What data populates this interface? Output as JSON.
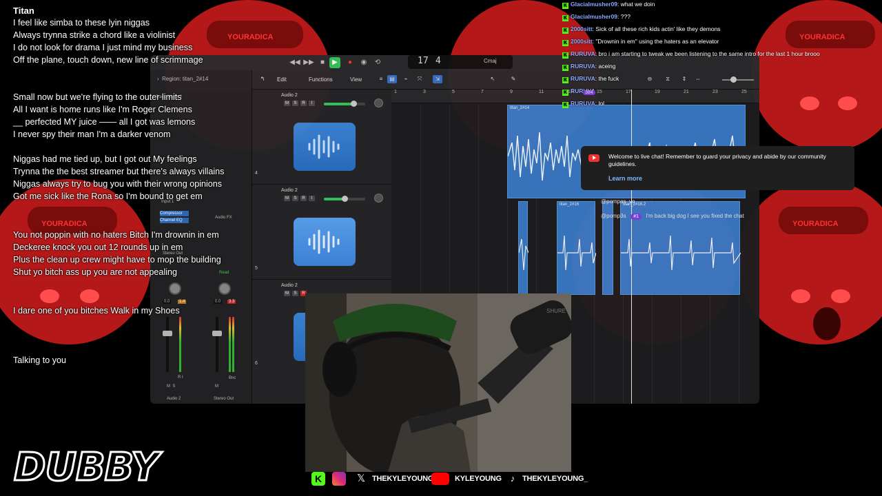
{
  "background": {
    "face_color": "#d21f1f",
    "brand_text": "YOURADICA"
  },
  "daw": {
    "region_label": "Region: titan_2#14",
    "track_label": "Track: Audio 2",
    "menus": [
      "Edit",
      "Functions",
      "View"
    ],
    "lcd": {
      "bar": "17",
      "beat": "4",
      "key": "Cmaj"
    },
    "ruler": [
      "1",
      "3",
      "5",
      "7",
      "9",
      "11",
      "13",
      "15",
      "17",
      "19",
      "21",
      "23",
      "25"
    ],
    "inspector": {
      "plugins": [
        "Compressor",
        "Channel EQ"
      ],
      "audio_fx": "Audio FX",
      "send_out": "Stereo Out",
      "read": "Read",
      "vol_a": "0.0",
      "vol_a_peak": "1.4",
      "vol_b": "0.0",
      "vol_b_peak": "3.3",
      "strip_a_name": "Audio 2",
      "strip_b_name": "Stereo Out",
      "bnc": "Bnc",
      "input": "Input 1"
    },
    "tracks": [
      {
        "num": "4",
        "name": "Audio 2",
        "volume": 0.72
      },
      {
        "num": "5",
        "name": "Audio 2",
        "volume": 0.5
      },
      {
        "num": "6",
        "name": "Audio 2",
        "volume": 0.5
      }
    ],
    "regions": [
      {
        "label": "titan_2#14"
      },
      {
        "label": "titan_2#16"
      },
      {
        "label": "titan_2#16.2"
      }
    ]
  },
  "lyrics": [
    "Titan",
    "I feel like simba to these lyin niggas",
    "Always trynna strike a chord like a violinist",
    "I do not look for drama I just mind my business",
    "Off the plane, touch down, new line of scrimmage",
    "",
    "Small now but we're flying to the outer limits",
    "All I want is home runs like I'm Roger Clemens",
    "__ perfected MY juice —— all I got was lemons",
    "I never spy  their man I'm a darker venom",
    "",
    "Niggas had me tied up, but I got out My feelings",
    "Trynna the the best streamer  but there's always villains",
    "Niggas always try to bug you with their wrong opinions",
    "Got me sick like the Rona so I'm bound to get em",
    "",
    "",
    "You not poppin with no haters Bitch I'm drownin in em",
    "Deckeree knock you out 12 rounds up in em",
    "Plus the clean up crew might have to mop the building",
    "Shut yo bitch ass up you are not appealing",
    "",
    "",
    "I dare one of you bitches Walk in my Shoes",
    "",
    "",
    "",
    "Talking to you"
  ],
  "chat": [
    {
      "user": "Glacialmusher09",
      "msg": "what we doin"
    },
    {
      "user": "Glacialmusher09",
      "msg": "???"
    },
    {
      "user": "2000sitt",
      "msg": "Sick of all these rich kids actin' like they demons"
    },
    {
      "user": "2000sitt",
      "msg": "\"Drownin in em\" using the haters as an elevator"
    },
    {
      "user": "RURUVA",
      "msg": "bro i am starting to tweak  we been listening to the same intro for the last 1 hour brooo"
    },
    {
      "user": "RURUVA",
      "msg": "aceing"
    },
    {
      "user": "RURUVA",
      "msg": "the fuck"
    },
    {
      "user": "RURUVA",
      "msg": ""
    },
    {
      "user": "RURUVA",
      "msg": "lol"
    }
  ],
  "welcome": {
    "text": "Welcome to live chat! Remember to guard your privacy and abide by our community guidelines.",
    "link": "Learn more"
  },
  "overchat": {
    "user1": "@pompas_vo",
    "user2": "@pomp3s",
    "badge": "#1",
    "msg": "I'm back big dog I see you fixed the chat",
    "count": "384"
  },
  "socials": {
    "handle1": "THEKYLEYOUNG",
    "handle2": "KYLEYOUNG",
    "handle3": "THEKYLEYOUNG_"
  },
  "logo": {
    "text": "DUBBY"
  },
  "webcam": {
    "mic_brand": "SHURE"
  }
}
